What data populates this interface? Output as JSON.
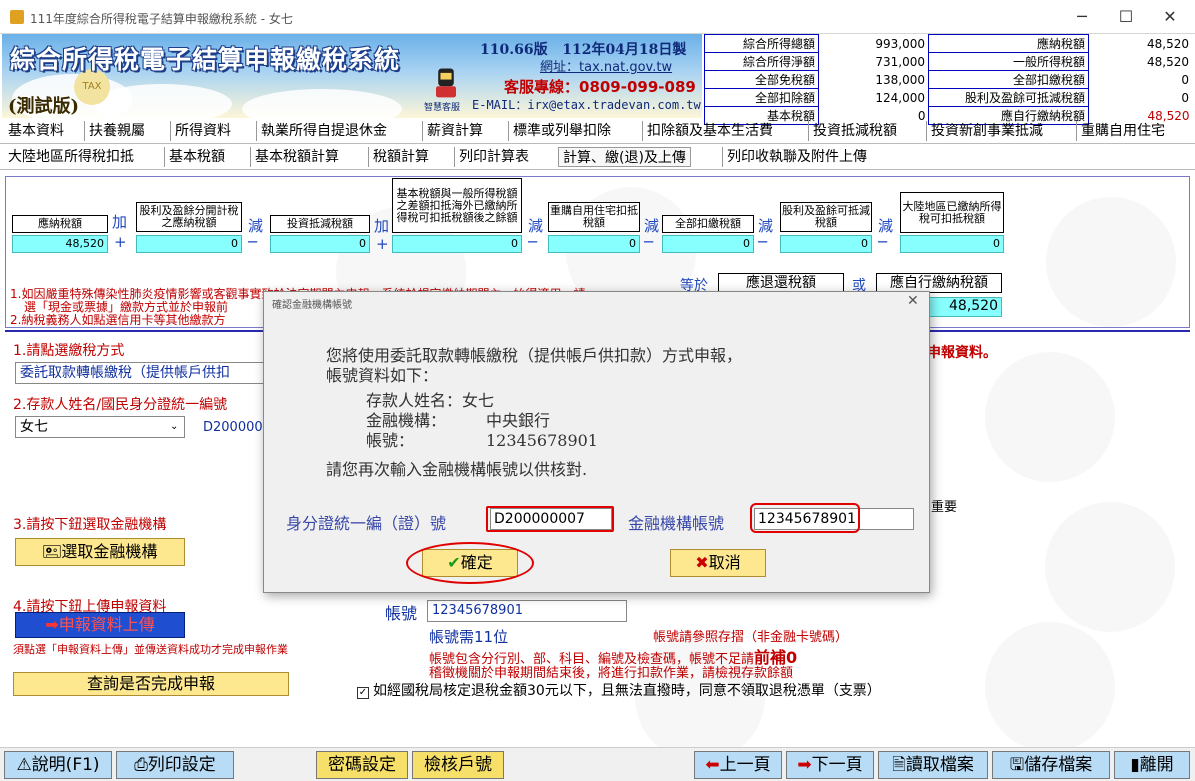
{
  "window": {
    "title": "111年度綜合所得稅電子結算申報繳稅系統 - 女七"
  },
  "banner": {
    "system_name": "綜合所得稅電子結算申報繳稅系統",
    "trial": "(測試版)",
    "version": "110.66版",
    "build_date": "112年04月18日製",
    "website": "網址：tax.nat.gov.tw",
    "hotline": "客服專線：0809-099-089",
    "email": "E-MAIL：irx@etax.tradevan.com.tw",
    "service_label": "智慧客服",
    "tax_deco": "TAX"
  },
  "summary": {
    "left": [
      {
        "label": "綜合所得總額",
        "value": "993,000"
      },
      {
        "label": "綜合所得淨額",
        "value": "731,000"
      },
      {
        "label": "全部免稅額",
        "value": "138,000"
      },
      {
        "label": "全部扣除額",
        "value": "124,000"
      },
      {
        "label": "基本稅額",
        "value": "0"
      }
    ],
    "right": [
      {
        "label": "應納稅額",
        "value": "48,520"
      },
      {
        "label": "一般所得稅額",
        "value": "48,520"
      },
      {
        "label": "全部扣繳稅額",
        "value": "0"
      },
      {
        "label": "股利及盈餘可抵減稅額",
        "value": "0"
      },
      {
        "label": "應自行繳納稅額",
        "value": "48,520"
      }
    ]
  },
  "menu1": [
    "基本資料",
    "扶養親屬",
    "所得資料",
    "執業所得自提退休金",
    "薪資計算",
    "標準或列舉扣除",
    "扣除額及基本生活費",
    "投資抵減稅額",
    "投資新創事業抵減",
    "重購自用住宅"
  ],
  "menu2": [
    "大陸地區所得稅扣抵",
    "基本稅額",
    "基本稅額計算",
    "稅額計算",
    "列印計算表",
    "計算、繳(退)及上傳",
    "列印收執聯及附件上傳"
  ],
  "calc": {
    "items": [
      {
        "label": "應納稅額",
        "value": "48,520"
      },
      {
        "label": "股利及盈餘分開計稅之應納稅額",
        "value": "0"
      },
      {
        "label": "投資抵減稅額",
        "value": "0"
      },
      {
        "label": "基本稅額與一般所得稅額之差額扣抵海外已繳納所得稅可扣抵稅額後之餘額",
        "value": "0"
      },
      {
        "label": "重購自用住宅扣抵稅額",
        "value": "0"
      },
      {
        "label": "全部扣繳稅額",
        "value": "0"
      },
      {
        "label": "股利及盈餘可抵減稅額",
        "value": "0"
      },
      {
        "label": "大陸地區已繳納所得稅可扣抵稅額",
        "value": "0"
      }
    ],
    "ops": {
      "plus": "加",
      "minus": "減",
      "plus_sym": "+",
      "minus_sym": "─"
    },
    "equals": "等於",
    "or": "或",
    "refund_label": "應退還稅額",
    "selfpay_label": "應自行繳納稅額",
    "selfpay_value": "48,520",
    "note1": "1.如因嚴重特殊傳染性肺炎疫情影響或客觀事實致於法定期間內申報，系統於規定繳納期間內，始得適用，請",
    "note1b": "選「現金或票據」繳款方式並於申報前",
    "note2": "2.納稅義務人如點選信用卡等其他繳款方"
  },
  "form": {
    "step1": "1.請點選繳稅方式",
    "method_value": "委託取款轉帳繳稅（提供帳戶供扣",
    "step2": "2.存款人姓名/國民身分證統一編號",
    "name_value": "女七",
    "id_value": "D200000",
    "step3": "3.請按下鈕選取金融機構",
    "select_bank_btn": "選取金融機構",
    "step4": "4.請按下鈕上傳申報資料",
    "upload_btn": "申報資料上傳",
    "upload_note": "須點選「申報資料上傳」並傳送資料成功才完成申報作業",
    "query_btn": "查詢是否完成申報",
    "account_label": "帳號",
    "account_value": "12345678901",
    "account_digits": "帳號需11位",
    "account_hint": "帳號請參照存摺（非金融卡號碼）",
    "account_note1": "帳號包含分行別、部、科目、編號及檢查碼，帳號不足請",
    "account_note1b": "前補0",
    "account_note2": "稽徵機關於申報期間結束後，將進行扣款作業，請檢視存款餘額",
    "checkbox_label": "如經國稅局核定退稅金額30元以下，且無法直撥時，同意不領取退稅憑單（支票）",
    "right_red": "申報資料。",
    "important": "重要"
  },
  "dialog": {
    "title": "確認金融機構帳號",
    "line1": "您將使用委託取款轉帳繳稅（提供帳戶供扣款）方式申報，",
    "line2": "帳號資料如下：",
    "name_label": "存款人姓名：",
    "name_value": "女七",
    "bank_label": "金融機構：",
    "bank_value": "中央銀行",
    "acct_label": "帳號：",
    "acct_value": "12345678901",
    "prompt": "請您再次輸入金融機構帳號以供核對.",
    "id_field_label": "身分證統一編（證）號",
    "id_field_value": "D200000007",
    "acct_field_label": "金融機構帳號",
    "acct_field_value": "12345678901",
    "ok": "確定",
    "cancel": "取消"
  },
  "bottom": {
    "help": "說明(F1)",
    "print_setup": "列印設定",
    "password": "密碼設定",
    "check_id": "檢核戶號",
    "prev": "上一頁",
    "next": "下一頁",
    "read": "讀取檔案",
    "save": "儲存檔案",
    "exit": "離開"
  }
}
